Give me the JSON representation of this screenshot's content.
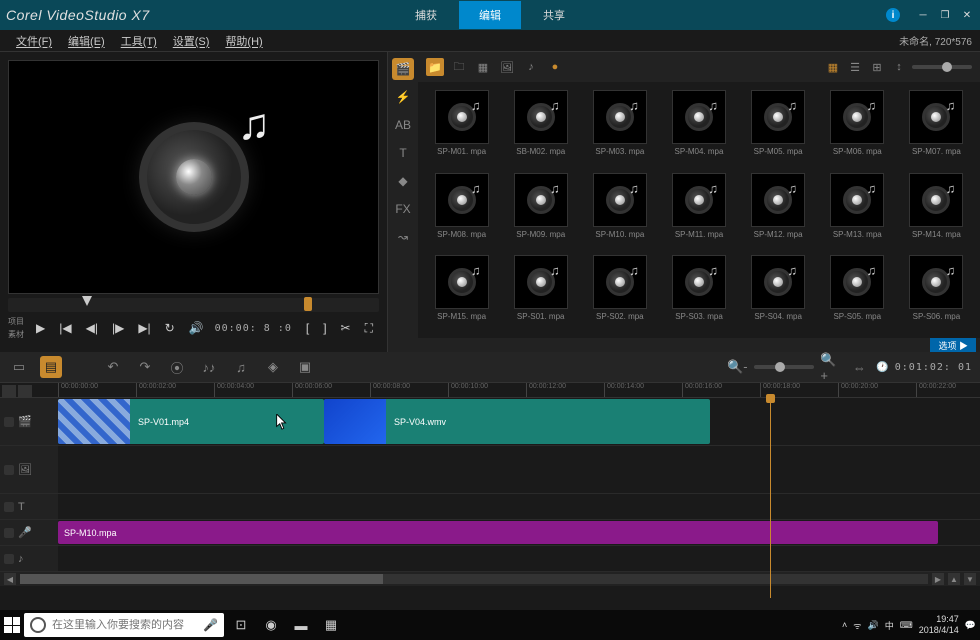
{
  "app": {
    "title": "Corel VideoStudio X7"
  },
  "top_tabs": {
    "capture": "捕获",
    "edit": "编辑",
    "share": "共享"
  },
  "menu": {
    "file": "文件(F)",
    "edit": "编辑(E)",
    "tools": "工具(T)",
    "settings": "设置(S)",
    "help": "帮助(H)"
  },
  "doc": {
    "name": "未命名,",
    "dims": "720*576"
  },
  "preview": {
    "mode_project": "项目",
    "mode_material": "素材",
    "timecode": "00:00: 8 :0"
  },
  "library": {
    "items": [
      "SP-M01. mpa",
      "SB-M02. mpa",
      "SP-M03. mpa",
      "SP-M04. mpa",
      "SP-M05. mpa",
      "SP-M06. mpa",
      "SP-M07. mpa",
      "SP-M08. mpa",
      "SP-M09. mpa",
      "SP-M10. mpa",
      "SP-M11. mpa",
      "SP-M12. mpa",
      "SP-M13. mpa",
      "SP-M14. mpa",
      "SP-M15. mpa",
      "SP-S01. mpa",
      "SP-S02. mpa",
      "SP-S03. mpa",
      "SP-S04. mpa",
      "SP-S05. mpa",
      "SP-S06. mpa"
    ],
    "options_btn": "选项 ▶"
  },
  "timeline": {
    "pos": "0:01:02: 01",
    "ruler": [
      "00:00:00:00",
      "00:00:02:00",
      "00:00:04:00",
      "00:00:06:00",
      "00:00:08:00",
      "00:00:10:00",
      "00:00:12:00",
      "00:00:14:00",
      "00:00:16:00",
      "00:00:18:00",
      "00:00:20:00",
      "00:00:22:00"
    ],
    "clip1": "SP-V01.mp4",
    "clip2": "SP-V04.wmv",
    "clip_audio": "SP-M10.mpa"
  },
  "taskbar": {
    "search_placeholder": "在这里输入你要搜索的内容",
    "lang": "中",
    "time": "19:47",
    "date": "2018/4/14"
  }
}
